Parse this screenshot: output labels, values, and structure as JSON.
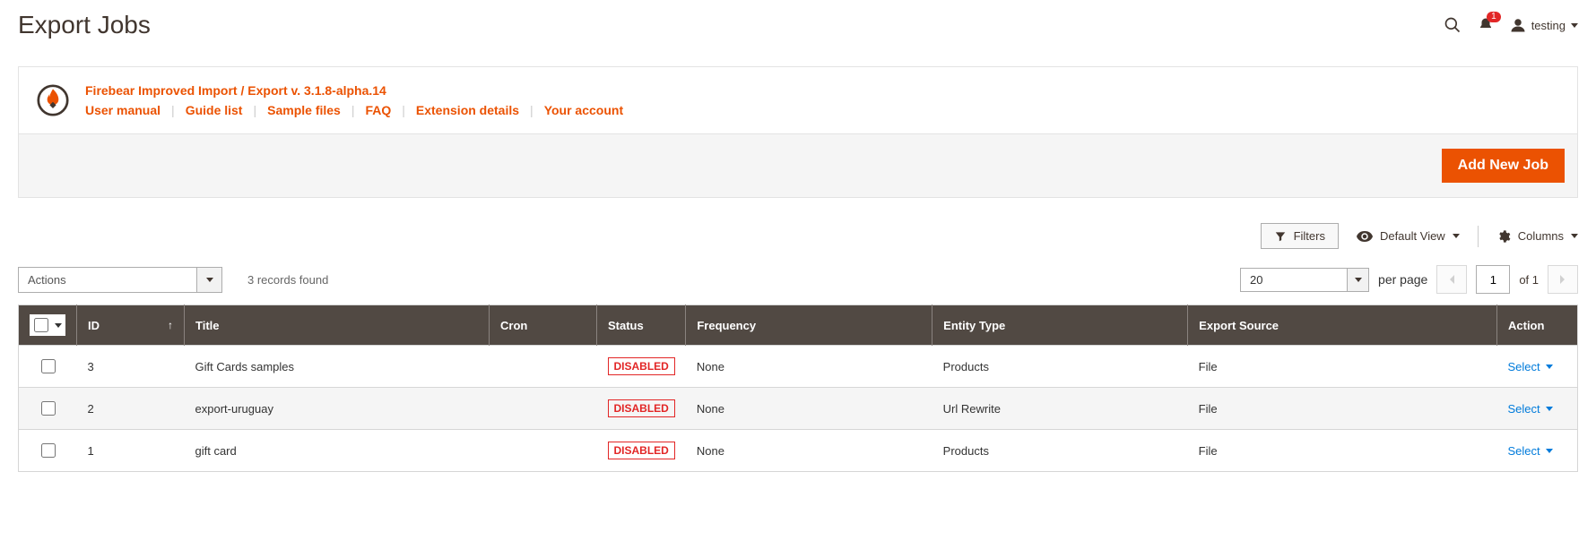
{
  "header": {
    "title": "Export Jobs",
    "notification_count": "1",
    "user_name": "testing"
  },
  "info_panel": {
    "title": "Firebear Improved Import / Export v. 3.1.8-alpha.14",
    "links": [
      "User manual",
      "Guide list",
      "Sample files",
      "FAQ",
      "Extension details",
      "Your account"
    ]
  },
  "toolbar": {
    "add_button": "Add New Job"
  },
  "grid_controls": {
    "filters_label": "Filters",
    "default_view_label": "Default View",
    "columns_label": "Columns",
    "actions_placeholder": "Actions",
    "records_found": "3 records found",
    "per_page_value": "20",
    "per_page_label": "per page",
    "page_current": "1",
    "page_of_label": "of 1"
  },
  "columns": {
    "id": "ID",
    "title": "Title",
    "cron": "Cron",
    "status": "Status",
    "frequency": "Frequency",
    "entity_type": "Entity Type",
    "export_source": "Export Source",
    "action": "Action"
  },
  "status_label": "DISABLED",
  "select_label": "Select",
  "rows": [
    {
      "id": "3",
      "title": "Gift Cards samples",
      "cron": "",
      "status": "DISABLED",
      "frequency": "None",
      "entity_type": "Products",
      "export_source": "File"
    },
    {
      "id": "2",
      "title": "export-uruguay",
      "cron": "",
      "status": "DISABLED",
      "frequency": "None",
      "entity_type": "Url Rewrite",
      "export_source": "File"
    },
    {
      "id": "1",
      "title": "gift card",
      "cron": "",
      "status": "DISABLED",
      "frequency": "None",
      "entity_type": "Products",
      "export_source": "File"
    }
  ]
}
